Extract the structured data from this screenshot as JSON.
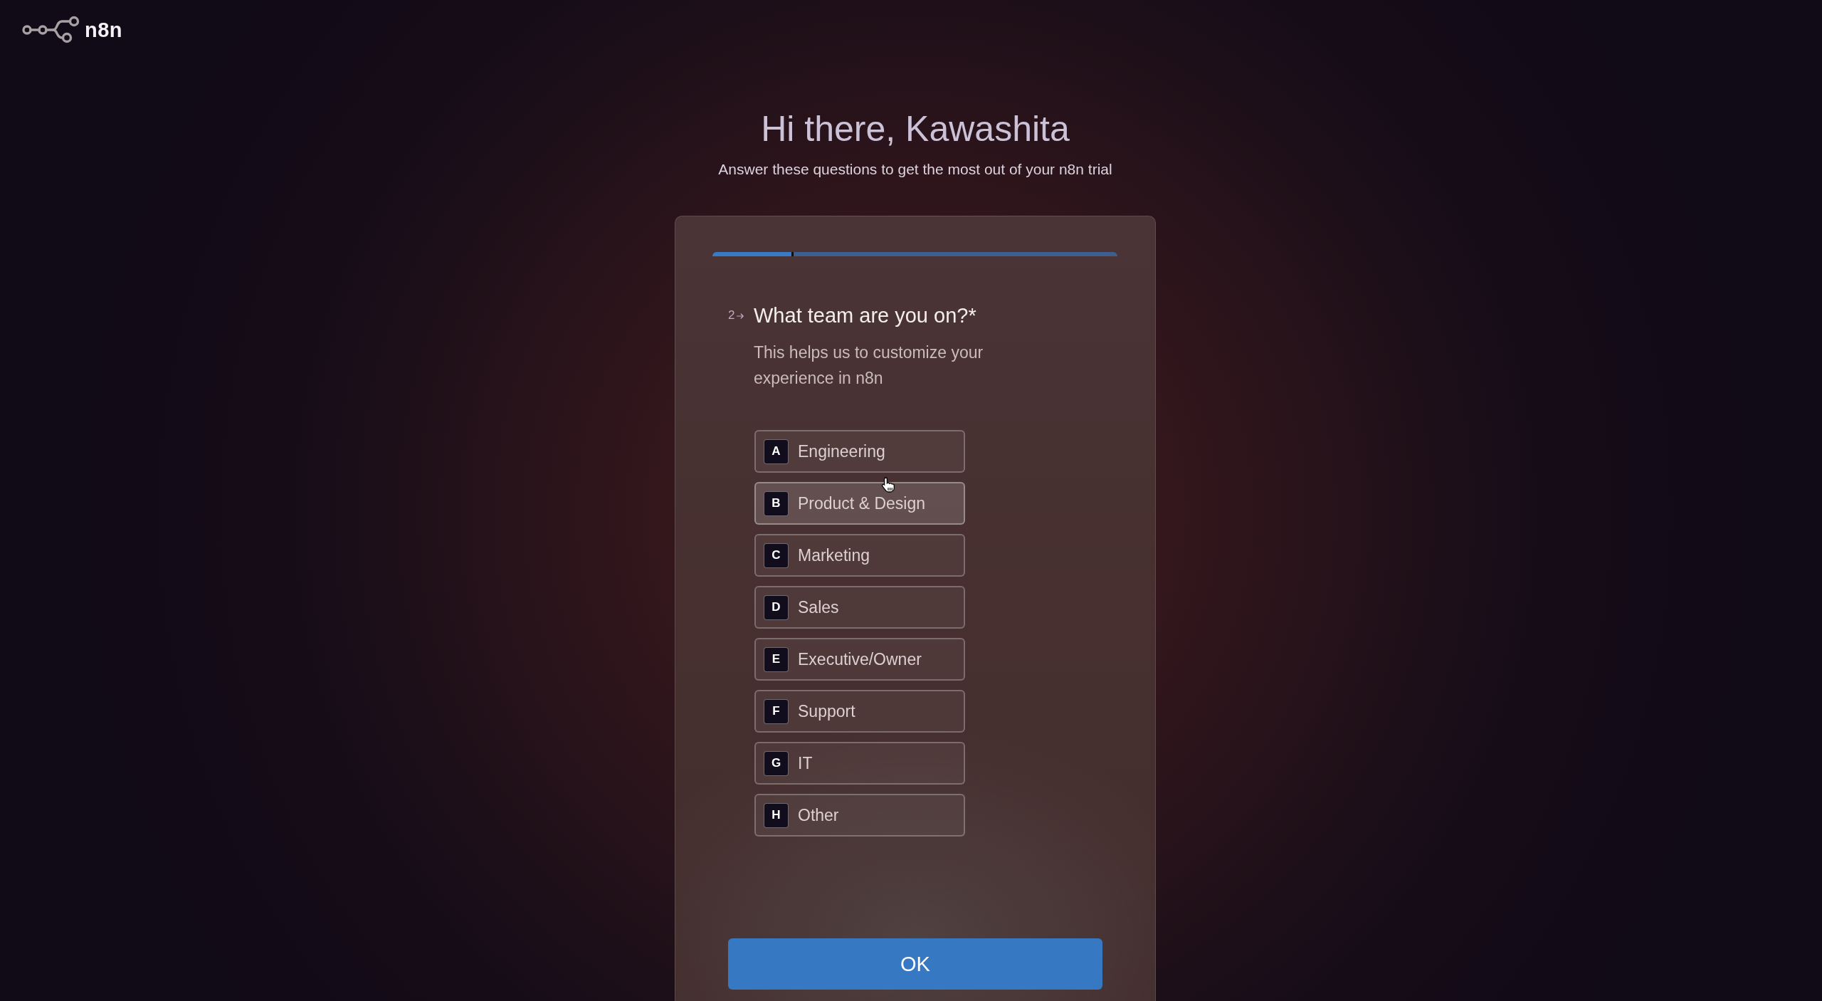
{
  "header": {
    "logo_text": "n8n"
  },
  "intro": {
    "title": "Hi there, Kawashita",
    "subtitle": "Answer these questions to get the most out of your n8n trial"
  },
  "survey": {
    "progress": {
      "level": 0.2
    },
    "question": {
      "number": "2",
      "title": "What team are you on?*",
      "description": "This helps us to customize your experience in n8n"
    },
    "options": [
      {
        "key": "A",
        "label": "Engineering",
        "hovered": false
      },
      {
        "key": "B",
        "label": "Product & Design",
        "hovered": true
      },
      {
        "key": "C",
        "label": "Marketing",
        "hovered": false
      },
      {
        "key": "D",
        "label": "Sales",
        "hovered": false
      },
      {
        "key": "E",
        "label": "Executive/Owner",
        "hovered": false
      },
      {
        "key": "F",
        "label": "Support",
        "hovered": false
      },
      {
        "key": "G",
        "label": "IT",
        "hovered": false
      },
      {
        "key": "H",
        "label": "Other",
        "hovered": false
      }
    ],
    "submit_button": {
      "label": "OK"
    }
  }
}
